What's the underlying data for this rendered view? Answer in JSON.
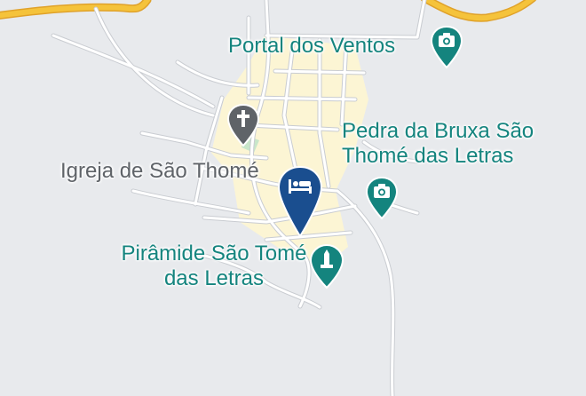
{
  "places": [
    {
      "name": "Portal dos Ventos",
      "category": "tourist-attraction",
      "icon": "camera-icon",
      "color": "#14847e"
    },
    {
      "name": "Pedra da Bruxa São Thomé das Letras",
      "category": "tourist-attraction",
      "icon": "camera-icon",
      "color": "#14847e"
    },
    {
      "name": "Igreja de São Thomé",
      "category": "church",
      "icon": "cross-icon",
      "color": "#5f6368"
    },
    {
      "name": "Pirâmide São Tomé das Letras",
      "category": "monument",
      "icon": "monument-icon",
      "color": "#14847e"
    }
  ],
  "hotel_marker": {
    "icon": "bed-icon",
    "color": "#1a4e8f"
  },
  "colors": {
    "background": "#e8eaed",
    "road": "#ffffff",
    "road_outline": "#c9ccd1",
    "highway": "#f5c33b",
    "urban_area": "#fcf5d4",
    "park": "#c8e6c9"
  }
}
